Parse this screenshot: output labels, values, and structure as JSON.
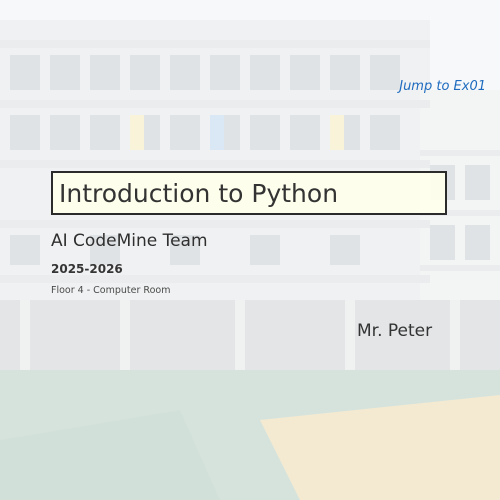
{
  "slide": {
    "jump_link": "Jump to Ex01",
    "title": "Introduction to Python",
    "team": "AI CodeMine Team",
    "year": "2025-2026",
    "location": "Floor 4 - Computer Room",
    "teacher": "Mr. Peter"
  },
  "colors": {
    "link": "#1e6bbf",
    "title_box_fill": "#ffffeb",
    "title_box_border": "#2b2b2b",
    "text": "#333333"
  },
  "background": {
    "description_icon": "school-building-courtyard-image"
  }
}
